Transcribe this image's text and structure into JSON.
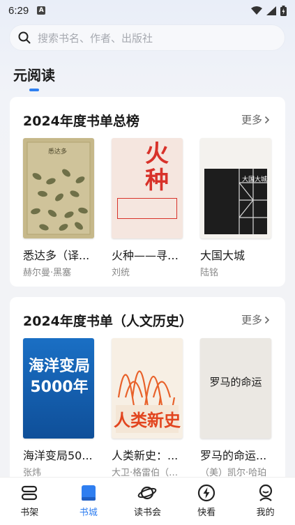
{
  "status_bar": {
    "time": "6:29",
    "notif_icon": "A"
  },
  "search": {
    "placeholder": "搜索书名、作者、出版社"
  },
  "page_title": "元阅读",
  "sections": [
    {
      "title": "2024年度书单总榜",
      "more": "更多",
      "books": [
        {
          "title": "悉达多（译...",
          "author": "赫尔曼·黑塞",
          "cover_text": "悉达多"
        },
        {
          "title": "火种——寻找...",
          "author": "刘统",
          "cover_text": "火种"
        },
        {
          "title": "大国大城",
          "author": "陆铭",
          "cover_text": "大国大城"
        }
      ]
    },
    {
      "title": "2024年度书单（人文历史）",
      "more": "更多",
      "books": [
        {
          "title": "海洋变局50...",
          "author": "张炜",
          "cover_text": "海洋变局 5000年"
        },
        {
          "title": "人类新史：...",
          "author": "大卫·格雷伯（D...",
          "cover_text": "人类新史"
        },
        {
          "title": "罗马的命运...",
          "author": "（美）凯尔·哈珀",
          "cover_text": "罗马的命运"
        }
      ]
    }
  ],
  "tabs": [
    {
      "label": "书架",
      "icon": "bookshelf-icon",
      "active": false
    },
    {
      "label": "书城",
      "icon": "book-store-icon",
      "active": true
    },
    {
      "label": "读书会",
      "icon": "planet-icon",
      "active": false
    },
    {
      "label": "快看",
      "icon": "lightning-icon",
      "active": false
    },
    {
      "label": "我的",
      "icon": "profile-icon",
      "active": false
    }
  ],
  "colors": {
    "accent": "#2f7ef0",
    "background": "#f2f3f6"
  }
}
